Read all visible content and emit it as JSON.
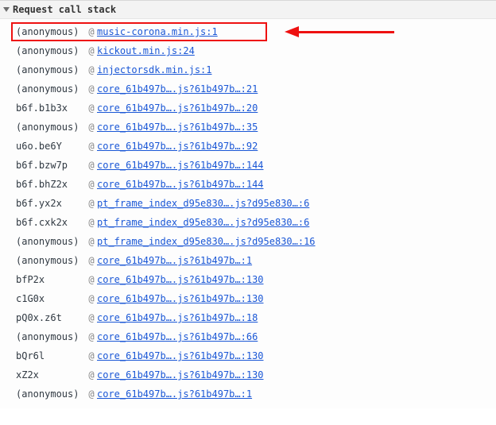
{
  "header": {
    "title": "Request call stack"
  },
  "at_symbol": "@",
  "stack": [
    {
      "fn": "(anonymous)",
      "loc": "music-corona.min.js:1",
      "highlighted": true
    },
    {
      "fn": "(anonymous)",
      "loc": "kickout.min.js:24"
    },
    {
      "fn": "(anonymous)",
      "loc": "injectorsdk.min.js:1"
    },
    {
      "fn": "(anonymous)",
      "loc": "core_61b497b….js?61b497b…:21"
    },
    {
      "fn": "b6f.b1b3x",
      "loc": "core_61b497b….js?61b497b…:20"
    },
    {
      "fn": "(anonymous)",
      "loc": "core_61b497b….js?61b497b…:35"
    },
    {
      "fn": "u6o.be6Y",
      "loc": "core_61b497b….js?61b497b…:92"
    },
    {
      "fn": "b6f.bzw7p",
      "loc": "core_61b497b….js?61b497b…:144"
    },
    {
      "fn": "b6f.bhZ2x",
      "loc": "core_61b497b….js?61b497b…:144"
    },
    {
      "fn": "b6f.yx2x",
      "loc": "pt_frame_index_d95e830….js?d95e830…:6"
    },
    {
      "fn": "b6f.cxk2x",
      "loc": "pt_frame_index_d95e830….js?d95e830…:6"
    },
    {
      "fn": "(anonymous)",
      "loc": "pt_frame_index_d95e830….js?d95e830…:16"
    },
    {
      "fn": "(anonymous)",
      "loc": "core_61b497b….js?61b497b…:1"
    },
    {
      "fn": "bfP2x",
      "loc": "core_61b497b….js?61b497b…:130"
    },
    {
      "fn": "c1G0x",
      "loc": "core_61b497b….js?61b497b…:130"
    },
    {
      "fn": "pQ0x.z6t",
      "loc": "core_61b497b….js?61b497b…:18"
    },
    {
      "fn": "(anonymous)",
      "loc": "core_61b497b….js?61b497b…:66"
    },
    {
      "fn": "bQr6l",
      "loc": "core_61b497b….js?61b497b…:130"
    },
    {
      "fn": "xZ2x",
      "loc": "core_61b497b….js?61b497b…:130"
    },
    {
      "fn": "(anonymous)",
      "loc": "core_61b497b….js?61b497b…:1"
    }
  ]
}
